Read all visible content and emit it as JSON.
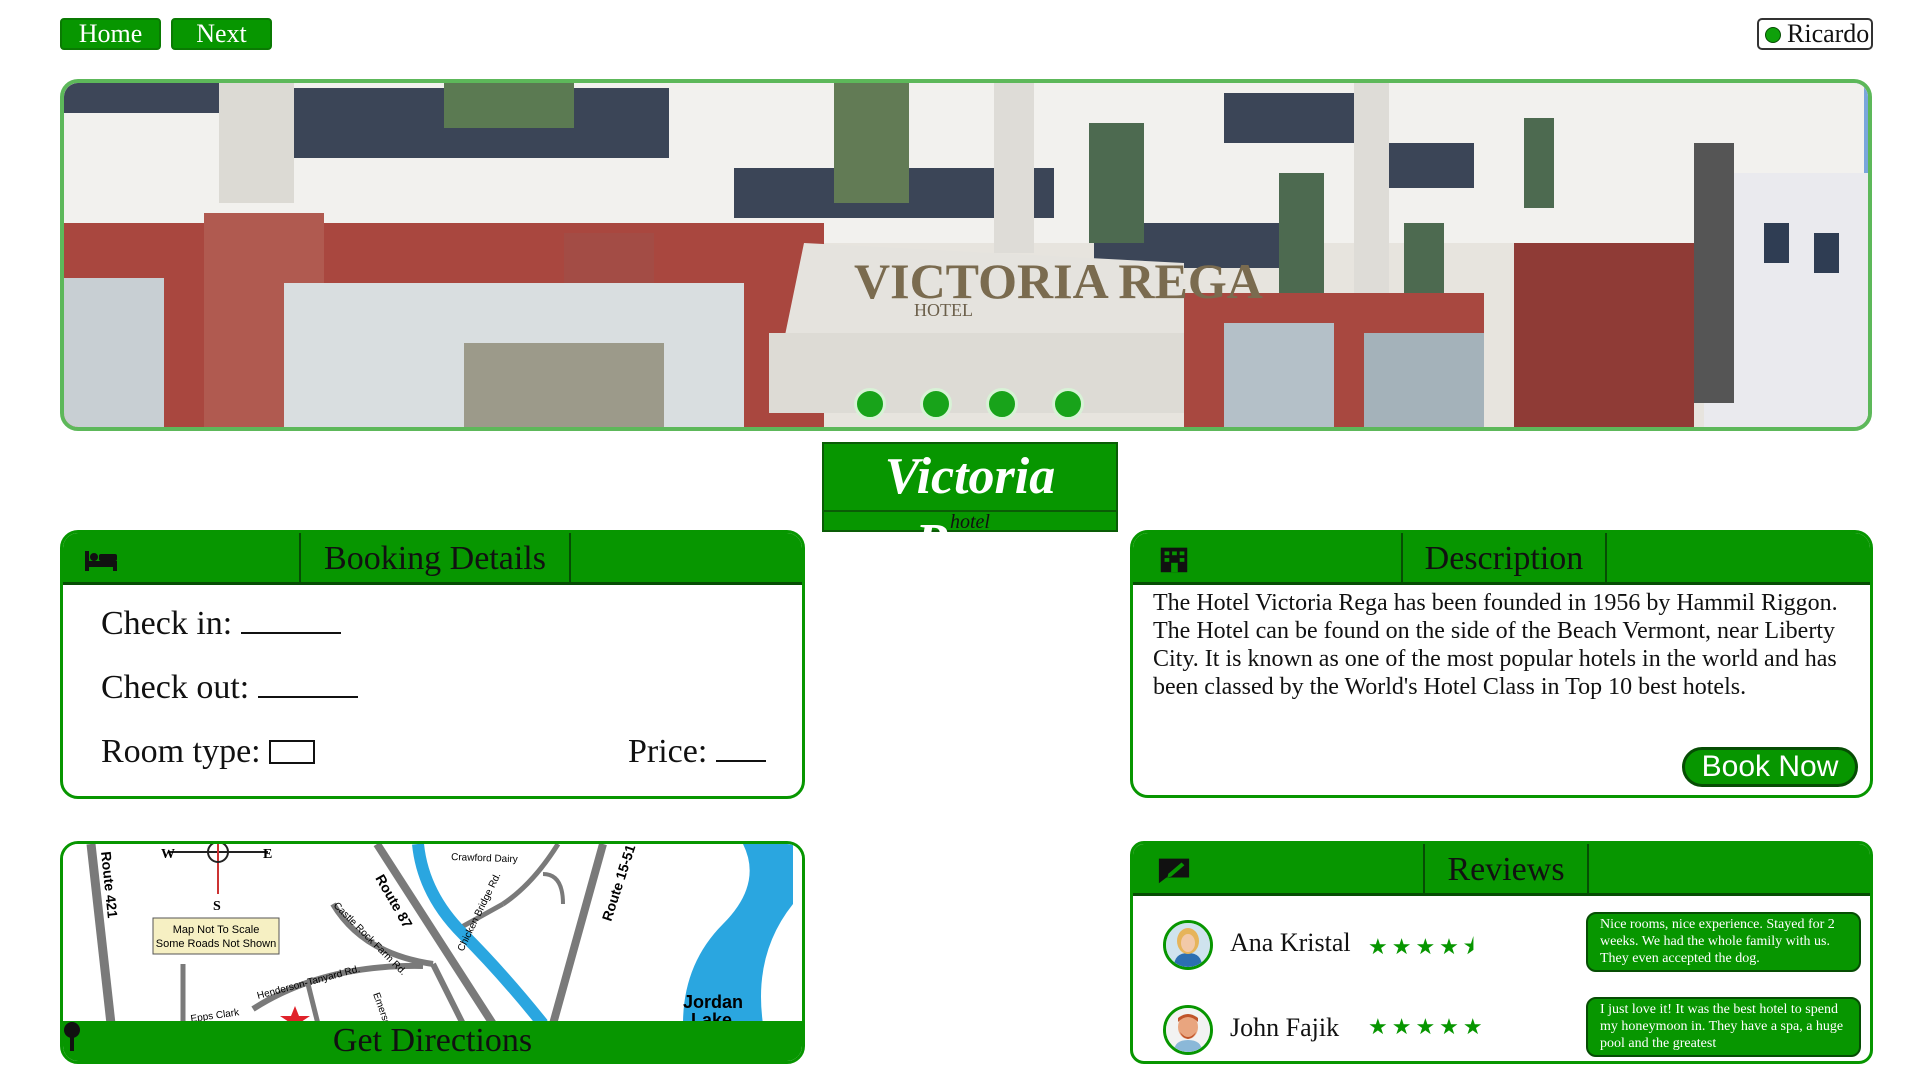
{
  "nav": {
    "home_label": "Home",
    "next_label": "Next"
  },
  "user": {
    "name": "Ricardo",
    "status_color": "#0ea10a"
  },
  "banner": {
    "sign_line1": "VICTORIA REGA",
    "sign_line2": "HOTEL",
    "slide_count": 4
  },
  "hotel": {
    "name": "Victoria Rega",
    "subtitle": "hotel"
  },
  "booking": {
    "title": "Booking Details",
    "icon": "bed-icon",
    "check_in_label": "Check in:",
    "check_out_label": "Check out:",
    "room_type_label": "Room type:",
    "price_label": "Price:"
  },
  "description": {
    "title": "Description",
    "icon": "building-icon",
    "text": "The Hotel Victoria Rega has been founded in 1956 by Hammil Riggon. The Hotel can be found on the side of the Beach Vermont, near Liberty City. It is known as one of the most popular hotels in the world and has been classed by the World's Hotel Class in Top 10 best hotels.",
    "book_label": "Book Now"
  },
  "map": {
    "directions_label": "Get Directions",
    "compass": {
      "west": "W",
      "east": "E",
      "south": "S"
    },
    "note_line1": "Map Not To Scale",
    "note_line2": "Some Roads Not Shown",
    "roads": {
      "route421": "Route 421",
      "route87": "Route 87",
      "route1551": "Route 15-51",
      "crawford": "Crawford Dairy",
      "castle_rock": "Castle Rock Farm Rd.",
      "chicken_bridge": "Chicken Bridge Rd.",
      "henderson": "Henderson-Tanyard Rd.",
      "epps": "Epps Clark",
      "emerson": "Emerson",
      "jordan": "Jordan",
      "lake": "Lake"
    }
  },
  "reviews": {
    "title": "Reviews",
    "icon": "review-icon",
    "items": [
      {
        "name": "Ana Kristal",
        "stars": "★★★★⯨",
        "rating": 4.5,
        "text": "Nice rooms, nice experience. Stayed for 2 weeks. We had the whole family with us. They even accepted the dog."
      },
      {
        "name": "John Fajik",
        "stars": "★★★★★",
        "rating": 5,
        "text": "I just love it! It was the best hotel to spend my honeymoon in. They have a spa, a huge pool and the greatest"
      }
    ]
  },
  "colors": {
    "accent": "#079600",
    "dark_accent": "#064d04",
    "banner_border": "#5db85a"
  }
}
